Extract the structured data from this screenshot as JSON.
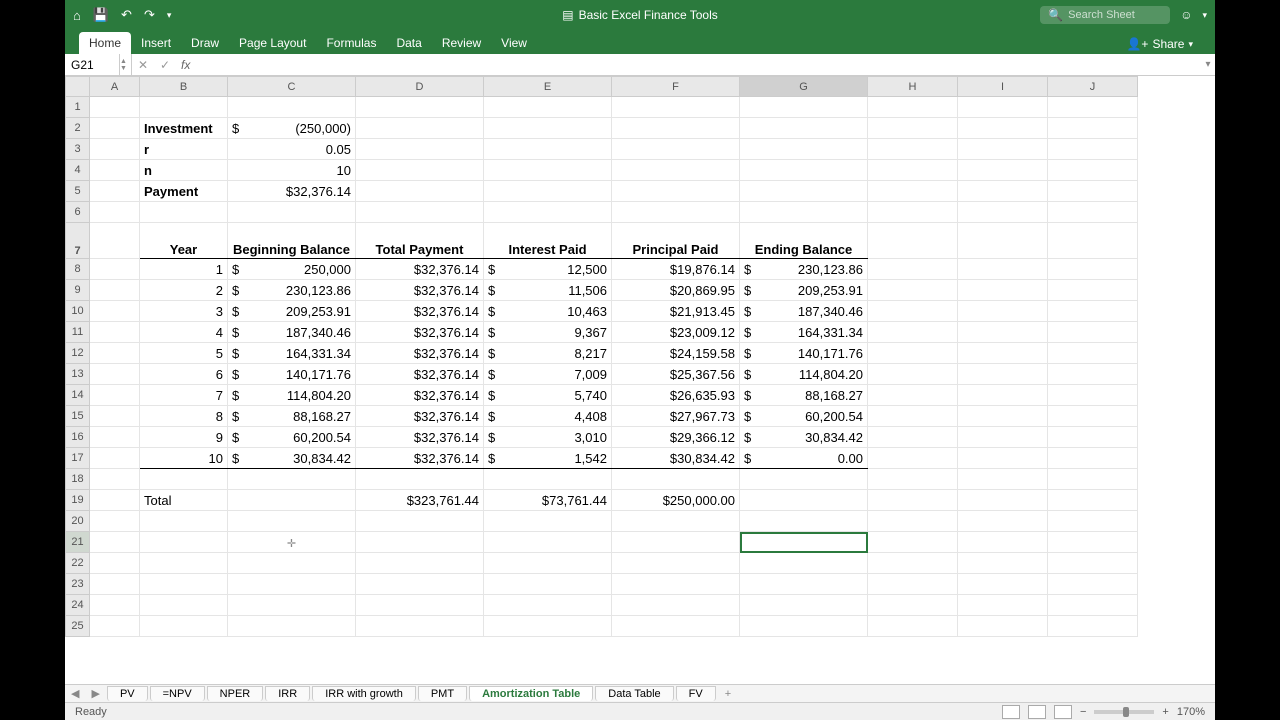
{
  "title": "Basic Excel Finance Tools",
  "search_ph": "Search Sheet",
  "ribbon": [
    "Home",
    "Insert",
    "Draw",
    "Page Layout",
    "Formulas",
    "Data",
    "Review",
    "View"
  ],
  "share": "Share",
  "name_box": "G21",
  "fx": "fx",
  "cols": [
    "A",
    "B",
    "C",
    "D",
    "E",
    "F",
    "G",
    "H",
    "I",
    "J"
  ],
  "params": {
    "inv_lbl": "Investment",
    "inv_sym": "$",
    "inv_val": "(250,000)",
    "r_lbl": "r",
    "r_val": "0.05",
    "n_lbl": "n",
    "n_val": "10",
    "pay_lbl": "Payment",
    "pay_val": "$32,376.14"
  },
  "headers": {
    "yr": "Year",
    "bb": "Beginning Balance",
    "tp": "Total Payment",
    "ip": "Interest Paid",
    "pp": "Principal Paid",
    "eb": "Ending Balance"
  },
  "rows": [
    {
      "y": "1",
      "bb": "250,000",
      "tp": "$32,376.14",
      "ip": "12,500",
      "pp": "$19,876.14",
      "eb": "230,123.86"
    },
    {
      "y": "2",
      "bb": "230,123.86",
      "tp": "$32,376.14",
      "ip": "11,506",
      "pp": "$20,869.95",
      "eb": "209,253.91"
    },
    {
      "y": "3",
      "bb": "209,253.91",
      "tp": "$32,376.14",
      "ip": "10,463",
      "pp": "$21,913.45",
      "eb": "187,340.46"
    },
    {
      "y": "4",
      "bb": "187,340.46",
      "tp": "$32,376.14",
      "ip": "9,367",
      "pp": "$23,009.12",
      "eb": "164,331.34"
    },
    {
      "y": "5",
      "bb": "164,331.34",
      "tp": "$32,376.14",
      "ip": "8,217",
      "pp": "$24,159.58",
      "eb": "140,171.76"
    },
    {
      "y": "6",
      "bb": "140,171.76",
      "tp": "$32,376.14",
      "ip": "7,009",
      "pp": "$25,367.56",
      "eb": "114,804.20"
    },
    {
      "y": "7",
      "bb": "114,804.20",
      "tp": "$32,376.14",
      "ip": "5,740",
      "pp": "$26,635.93",
      "eb": "88,168.27"
    },
    {
      "y": "8",
      "bb": "88,168.27",
      "tp": "$32,376.14",
      "ip": "4,408",
      "pp": "$27,967.73",
      "eb": "60,200.54"
    },
    {
      "y": "9",
      "bb": "60,200.54",
      "tp": "$32,376.14",
      "ip": "3,010",
      "pp": "$29,366.12",
      "eb": "30,834.42"
    },
    {
      "y": "10",
      "bb": "30,834.42",
      "tp": "$32,376.14",
      "ip": "1,542",
      "pp": "$30,834.42",
      "eb": "0.00"
    }
  ],
  "total": {
    "lbl": "Total",
    "tp": "$323,761.44",
    "ip": "$73,761.44",
    "pp": "$250,000.00"
  },
  "tabs": [
    "PV",
    "=NPV",
    "NPER",
    "IRR",
    "IRR with growth",
    "PMT",
    "Amortization Table",
    "Data Table",
    "FV"
  ],
  "active_tab": 6,
  "status": "Ready",
  "zoom": "170%",
  "dollar": "$"
}
